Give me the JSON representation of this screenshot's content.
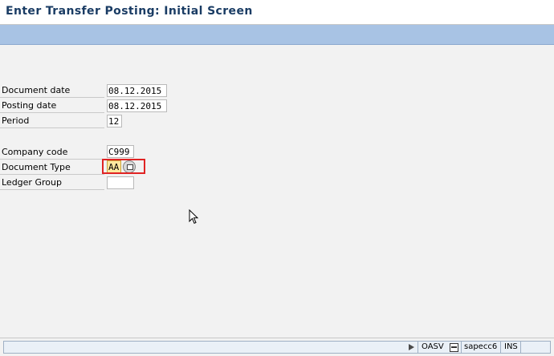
{
  "header": {
    "title": "Enter Transfer Posting: Initial Screen"
  },
  "form": {
    "document_date": {
      "label": "Document date",
      "value": "08.12.2015"
    },
    "posting_date": {
      "label": "Posting date",
      "value": "08.12.2015"
    },
    "period": {
      "label": "Period",
      "value": "12"
    },
    "company_code": {
      "label": "Company code",
      "value": "C999"
    },
    "document_type": {
      "label": "Document Type",
      "value": "AA"
    },
    "ledger_group": {
      "label": "Ledger Group",
      "value": ""
    }
  },
  "status_bar": {
    "transaction": "OASV",
    "system": "sapecc6",
    "mode": "INS"
  },
  "colors": {
    "title_text": "#1a3c64",
    "toolbar": "#a8c3e4",
    "highlight_field": "#ffe9a0",
    "callout": "#e02424"
  },
  "icons": {
    "f4_help": "value-help-icon",
    "status_play": "play-icon",
    "session": "session-icon",
    "cursor": "mouse-pointer-icon"
  }
}
